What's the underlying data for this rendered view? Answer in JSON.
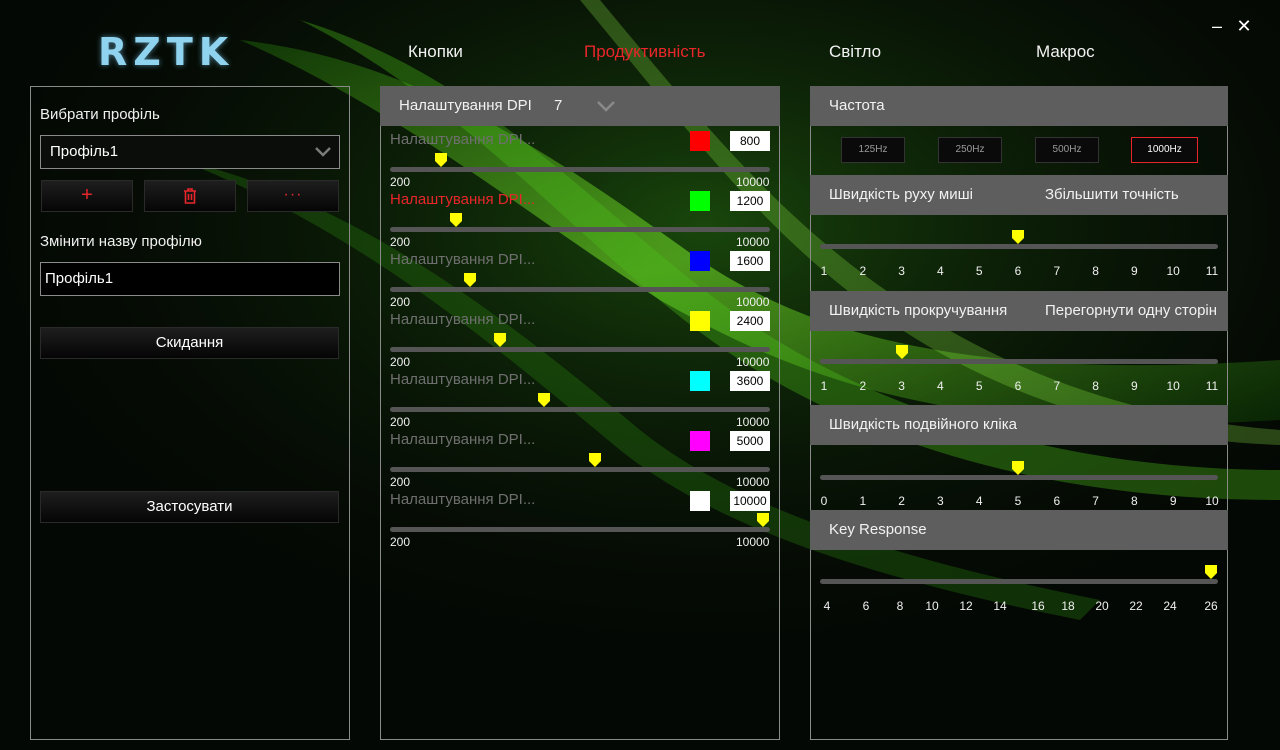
{
  "logo": "RZTK",
  "window": {
    "minimize": "–",
    "close": "✕"
  },
  "tabs": [
    "Кнопки",
    "Продуктивність",
    "Світло",
    "Макрос"
  ],
  "active_tab": 1,
  "left": {
    "profile_label": "Вибрати профіль",
    "profile_selected": "Профіль1",
    "rename_label": "Змінити назву профілю",
    "rename_value": "Профіль1",
    "add": "+",
    "more": "···",
    "reset": "Скидання",
    "apply": "Застосувати"
  },
  "dpi": {
    "header": "Налаштування DPI",
    "count": "7",
    "min_label": "200",
    "max_label": "10000",
    "min": 200,
    "max": 10000,
    "active_index": 1,
    "stages": [
      {
        "label": "Налаштування DPI...",
        "color": "#ff0000",
        "value": "800"
      },
      {
        "label": "Налаштування DPI...",
        "color": "#00ff00",
        "value": "1200"
      },
      {
        "label": "Налаштування DPI...",
        "color": "#0000ff",
        "value": "1600"
      },
      {
        "label": "Налаштування DPI...",
        "color": "#ffff00",
        "value": "2400"
      },
      {
        "label": "Налаштування DPI...",
        "color": "#00ffff",
        "value": "3600"
      },
      {
        "label": "Налаштування DPI...",
        "color": "#ff00ff",
        "value": "5000"
      },
      {
        "label": "Налаштування DPI...",
        "color": "#ffffff",
        "value": "10000"
      }
    ]
  },
  "right": {
    "frequency": {
      "title": "Частота",
      "options": [
        "125Hz",
        "250Hz",
        "500Hz",
        "1000Hz"
      ],
      "selected": 3
    },
    "mouse_speed": {
      "title": "Швидкість руху миші",
      "extra": "Збільшити точність",
      "ticks": [
        "1",
        "2",
        "3",
        "4",
        "5",
        "6",
        "7",
        "8",
        "9",
        "10",
        "11"
      ],
      "value": 6
    },
    "scroll_speed": {
      "title": "Швидкість прокручування",
      "extra": "Перегорнути одну сторінку",
      "ticks": [
        "1",
        "2",
        "3",
        "4",
        "5",
        "6",
        "7",
        "8",
        "9",
        "10",
        "11"
      ],
      "value": 3
    },
    "double_click": {
      "title": "Швидкість подвійного кліка",
      "ticks": [
        "0",
        "1",
        "2",
        "3",
        "4",
        "5",
        "6",
        "7",
        "8",
        "9",
        "10"
      ],
      "value": 5
    },
    "key_response": {
      "title": "Key Response",
      "ticks": [
        "4",
        "6",
        "8",
        "10",
        "12",
        "14",
        "16",
        "18",
        "20",
        "22",
        "24",
        "26"
      ],
      "value": 26
    }
  },
  "colors": {
    "accent": "#e8262a",
    "thumb": "#ffff00"
  }
}
